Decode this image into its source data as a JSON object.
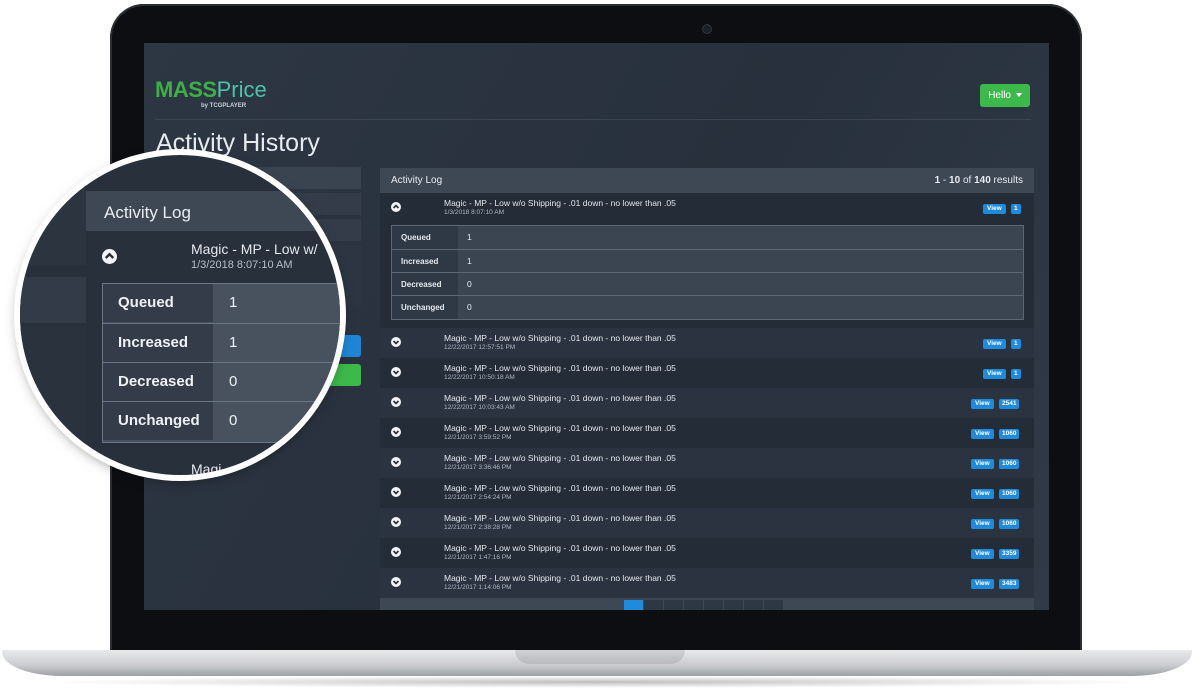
{
  "app": {
    "logo_mass": "MASS",
    "logo_price": "Price",
    "logo_by": "by TCGPLAYER",
    "hello_label": "Hello",
    "page_title": "Activity History"
  },
  "colors": {
    "accent_blue": "#1e8bdc",
    "accent_green": "#3db84b",
    "screen_bg": "#2d3643",
    "panel_header": "#3e4855"
  },
  "icons": {
    "expanded": "chevron-up-icon",
    "collapsed": "chevron-down-icon",
    "hello_caret": "caret-down-icon"
  },
  "activity_log": {
    "title": "Activity Log",
    "results_range_start": "1",
    "results_range_end": "10",
    "results_total": "140",
    "results_sep": " - ",
    "results_of": " of ",
    "results_suffix": " results",
    "view_label": "View",
    "entries": [
      {
        "name": "Magic - MP - Low w/o Shipping - .01 down - no lower than .05",
        "date": "1/3/2018 8:07:10 AM",
        "count": "1",
        "expanded": true
      },
      {
        "name": "Magic - MP - Low w/o Shipping - .01 down - no lower than .05",
        "date": "12/22/2017 12:57:51 PM",
        "count": "1"
      },
      {
        "name": "Magic - MP - Low w/o Shipping - .01 down - no lower than .05",
        "date": "12/22/2017 10:50:18 AM",
        "count": "1"
      },
      {
        "name": "Magic - MP - Low w/o Shipping - .01 down - no lower than .05",
        "date": "12/22/2017 10:03:43 AM",
        "count": "2541"
      },
      {
        "name": "Magic - MP - Low w/o Shipping - .01 down - no lower than .05",
        "date": "12/21/2017 3:59:52 PM",
        "count": "1060"
      },
      {
        "name": "Magic - MP - Low w/o Shipping - .01 down - no lower than .05",
        "date": "12/21/2017 3:36:46 PM",
        "count": "1060"
      },
      {
        "name": "Magic - MP - Low w/o Shipping - .01 down - no lower than .05",
        "date": "12/21/2017 2:54:24 PM",
        "count": "1060"
      },
      {
        "name": "Magic - MP - Low w/o Shipping - .01 down - no lower than .05",
        "date": "12/21/2017 2:38:28 PM",
        "count": "1060"
      },
      {
        "name": "Magic - MP - Low w/o Shipping - .01 down - no lower than .05",
        "date": "12/21/2017 1:47:16 PM",
        "count": "3359"
      },
      {
        "name": "Magic - MP - Low w/o Shipping - .01 down - no lower than .05",
        "date": "12/21/2017 1:14:06 PM",
        "count": "3483"
      }
    ],
    "stats": [
      {
        "label": "Queued",
        "value": "1"
      },
      {
        "label": "Increased",
        "value": "1"
      },
      {
        "label": "Decreased",
        "value": "0"
      },
      {
        "label": "Unchanged",
        "value": "0"
      }
    ]
  },
  "magnifier": {
    "title": "Activity Log",
    "entry_name": "Magic - MP - Low w/",
    "entry_date": "1/3/2018 8:07:10 AM",
    "bottom_text": "Magi"
  }
}
